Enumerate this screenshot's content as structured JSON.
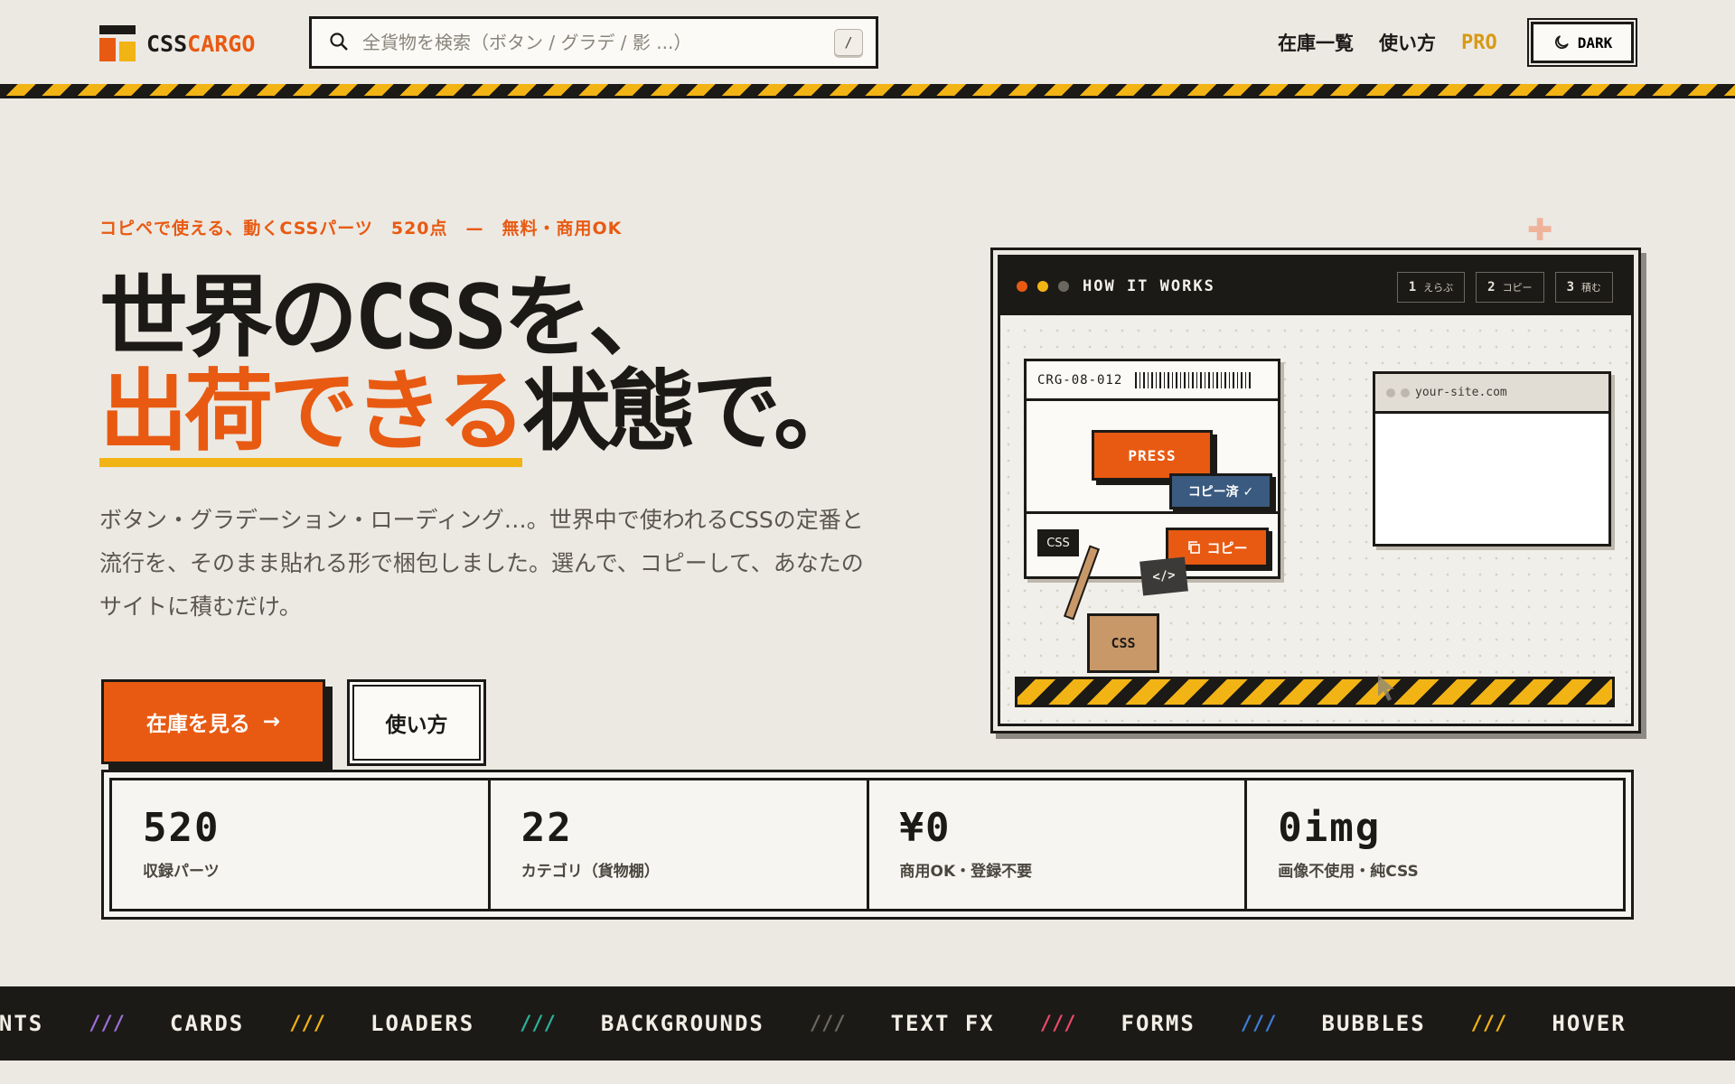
{
  "header": {
    "logo_part1": "CSS",
    "logo_part2": "CARGO",
    "search_placeholder": "全貨物を検索（ボタン / グラデ / 影 ...）",
    "search_shortcut": "/",
    "nav": [
      "在庫一覧",
      "使い方"
    ],
    "pro_label": "PRO",
    "dark_label": "DARK"
  },
  "hero": {
    "eyebrow": "コピペで使える、動くCSSパーツ　520点　—　無料・商用OK",
    "title_line1": "世界のCSSを、",
    "title_highlight": "出荷できる",
    "title_line2_rest": "状態で。",
    "description": "ボタン・グラデーション・ローディング…。世界中で使われるCSSの定番と流行を、そのまま貼れる形で梱包しました。選んで、コピーして、あなたのサイトに積むだけ。",
    "primary_cta": "在庫を見る",
    "primary_cta_arrow": "→",
    "secondary_cta": "使い方"
  },
  "stats": [
    {
      "value": "520",
      "label": "収録パーツ"
    },
    {
      "value": "22",
      "label": "カテゴリ（貨物棚）"
    },
    {
      "value": "¥0",
      "label": "商用OK・登録不要"
    },
    {
      "value": "0img",
      "label": "画像不使用・純CSS"
    }
  ],
  "how_it_works": {
    "title": "HOW IT WORKS",
    "steps": [
      {
        "num": "1",
        "label": "えらぶ"
      },
      {
        "num": "2",
        "label": "コピー"
      },
      {
        "num": "3",
        "label": "積む"
      }
    ],
    "crate_code": "CRG-08-012",
    "press_label": "PRESS",
    "copied_label": "コピー済 ✓",
    "css_tag": "CSS",
    "copy_label": "コピー",
    "code_chip": "</>",
    "box_label": "CSS",
    "site_url": "your-site.com"
  },
  "ticker": {
    "items": [
      "IENTS",
      "CARDS",
      "LOADERS",
      "BACKGROUNDS",
      "TEXT FX",
      "FORMS",
      "BUBBLES",
      "HOVER"
    ],
    "separator": "///",
    "separator_colors": [
      "#9b6fd6",
      "#f2b314",
      "#2bb39a",
      "#6b6760",
      "#e84a6a",
      "#3d7ed6",
      "#f2b314"
    ]
  },
  "colors": {
    "accent": "#e85a12",
    "yellow": "#f2b314",
    "ink": "#1c1a17",
    "background": "#ece9e3"
  }
}
